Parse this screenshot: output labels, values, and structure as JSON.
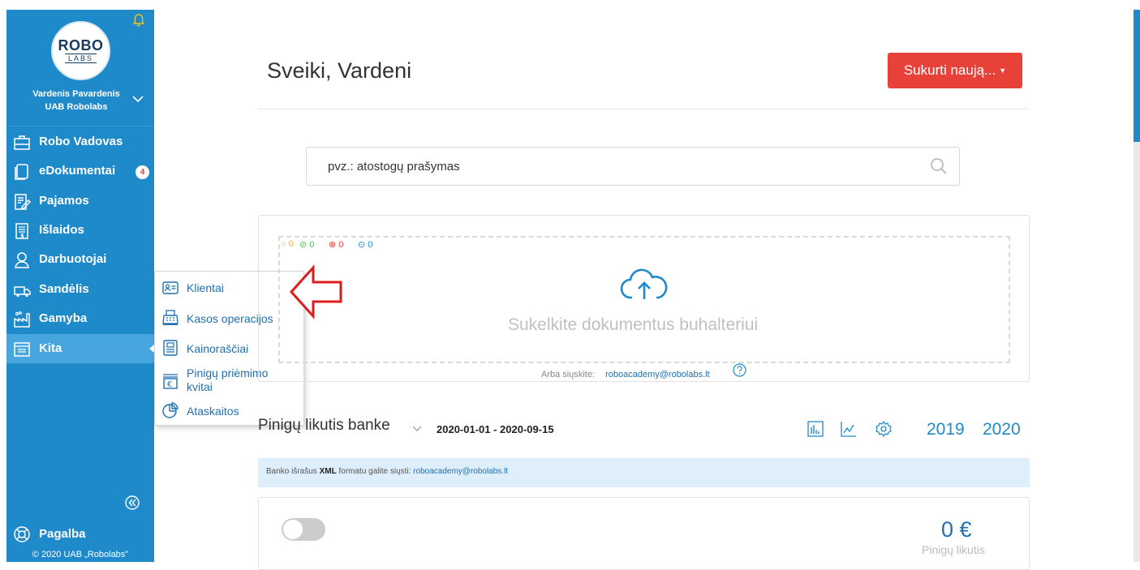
{
  "sidebar": {
    "logo_top": "ROBO",
    "logo_bottom": "LABS",
    "user_name": "Vardenis Pavardenis",
    "company": "UAB Robolabs",
    "items": [
      {
        "label": "Robo Vadovas",
        "icon": "briefcase-icon"
      },
      {
        "label": "eDokumentai",
        "icon": "documents-icon",
        "badge": "4"
      },
      {
        "label": "Pajamos",
        "icon": "invoice-pen-icon"
      },
      {
        "label": "Išlaidos",
        "icon": "receipt-icon"
      },
      {
        "label": "Darbuotojai",
        "icon": "employee-icon"
      },
      {
        "label": "Sandėlis",
        "icon": "truck-icon"
      },
      {
        "label": "Gamyba",
        "icon": "factory-icon"
      },
      {
        "label": "Kita",
        "icon": "other-icon",
        "active": true
      }
    ],
    "help_label": "Pagalba",
    "copyright": "© 2020 UAB „Robolabs\""
  },
  "dropdown": {
    "items": [
      {
        "label": "Klientai",
        "icon": "contact-card-icon"
      },
      {
        "label": "Kasos operacijos",
        "icon": "cash-register-icon"
      },
      {
        "label": "Kainoraščiai",
        "icon": "price-list-icon"
      },
      {
        "label": "Pinigų priėmimo kvitai",
        "line1": "Pinigų priėmimo",
        "line2": "kvitai",
        "icon": "euro-receipt-icon"
      },
      {
        "label": "Ataskaitos",
        "icon": "pie-chart-icon"
      }
    ]
  },
  "header": {
    "greeting": "Sveiki, Vardeni",
    "create_button": "Sukurti naują..."
  },
  "search": {
    "placeholder": "pvz.: atostogų prašymas"
  },
  "upload": {
    "stats": [
      {
        "value": "0",
        "color": "#f0ad4e",
        "icon": "pending-icon"
      },
      {
        "value": "0",
        "color": "#5cb85c",
        "icon": "check-icon"
      },
      {
        "value": "0",
        "color": "#e8413a",
        "icon": "error-icon"
      },
      {
        "value": "0",
        "color": "#1f8ac9",
        "icon": "question-icon"
      }
    ],
    "text": "Sukelkite dokumentus buhalteriui",
    "or_send": "Arba siųskite:",
    "email": "roboacademy@robolabs.lt"
  },
  "balance": {
    "title": "Pinigų likutis banke",
    "date_range": "2020-01-01 - 2020-09-15",
    "years": [
      "2019",
      "2020"
    ],
    "info_prefix": "Banko išrašus",
    "info_bold": "XML",
    "info_mid": "formatu galite siųsti:",
    "info_email": "roboacademy@robolabs.lt",
    "amount": "0 €",
    "amount_label": "Pinigų likutis"
  },
  "colors": {
    "sidebar": "#1f8ac9",
    "active": "#48a6de",
    "accent_red": "#e8413a",
    "link": "#1f6fb0"
  }
}
